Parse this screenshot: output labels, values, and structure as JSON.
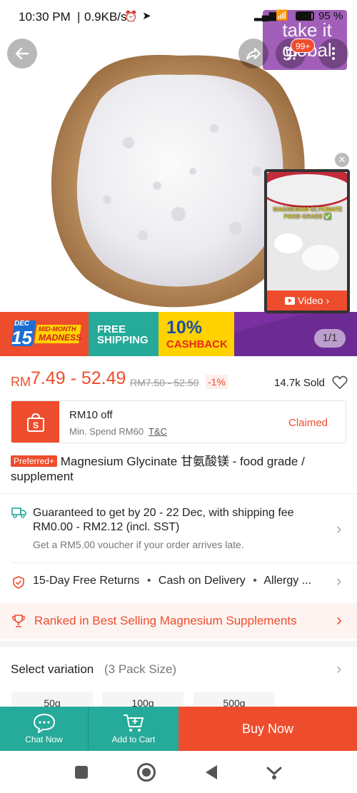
{
  "status": {
    "time": "10:30 PM",
    "speed": "0.9KB/s",
    "battery": "95"
  },
  "overlay": {
    "text": "take it global",
    "cart_badge": "99+"
  },
  "video": {
    "caption": "MAGNESIUM GLYCINATE FOOD GRADE ✅",
    "button": "Video"
  },
  "banner": {
    "dec": "DEC",
    "day": "15",
    "midmonth_line1": "MID-MONTH",
    "midmonth_line2": "MADNESS",
    "free1": "FREE",
    "free2": "SHIPPING",
    "cash_pct": "10%",
    "cash_word": "CASHBACK",
    "pager": "1/1"
  },
  "price": {
    "currency": "RM",
    "range": "7.49 - 52.49",
    "original": "RM7.50 - 52.50",
    "discount": "-1%",
    "sold": "14.7k Sold"
  },
  "voucher": {
    "title": "RM10 off",
    "sub": "Min. Spend RM60",
    "tc": "T&C",
    "status": "Claimed"
  },
  "product": {
    "badge": "Preferred+",
    "title": "Magnesium Glycinate 甘氨酸镁 - food grade / supplement"
  },
  "shipping": {
    "line": "Guaranteed to get by 20 - 22 Dec, with shipping fee RM0.00 - RM2.12 (incl. SST)",
    "sub": "Get a RM5.00 voucher if your order arrives late."
  },
  "returns": {
    "items": [
      "15-Day Free Returns",
      "Cash on Delivery",
      "Allergy ..."
    ]
  },
  "ranked": {
    "text": "Ranked in Best Selling Magnesium Supplements"
  },
  "variation": {
    "label": "Select variation",
    "count": "(3 Pack Size)",
    "options": [
      "50g",
      "100g",
      "500g"
    ]
  },
  "bottom": {
    "chat": "Chat Now",
    "cart": "Add to Cart",
    "buy": "Buy Now"
  },
  "colors": {
    "brand": "#ee4d2d",
    "teal": "#26aa99",
    "purple": "#7b2fa0"
  }
}
